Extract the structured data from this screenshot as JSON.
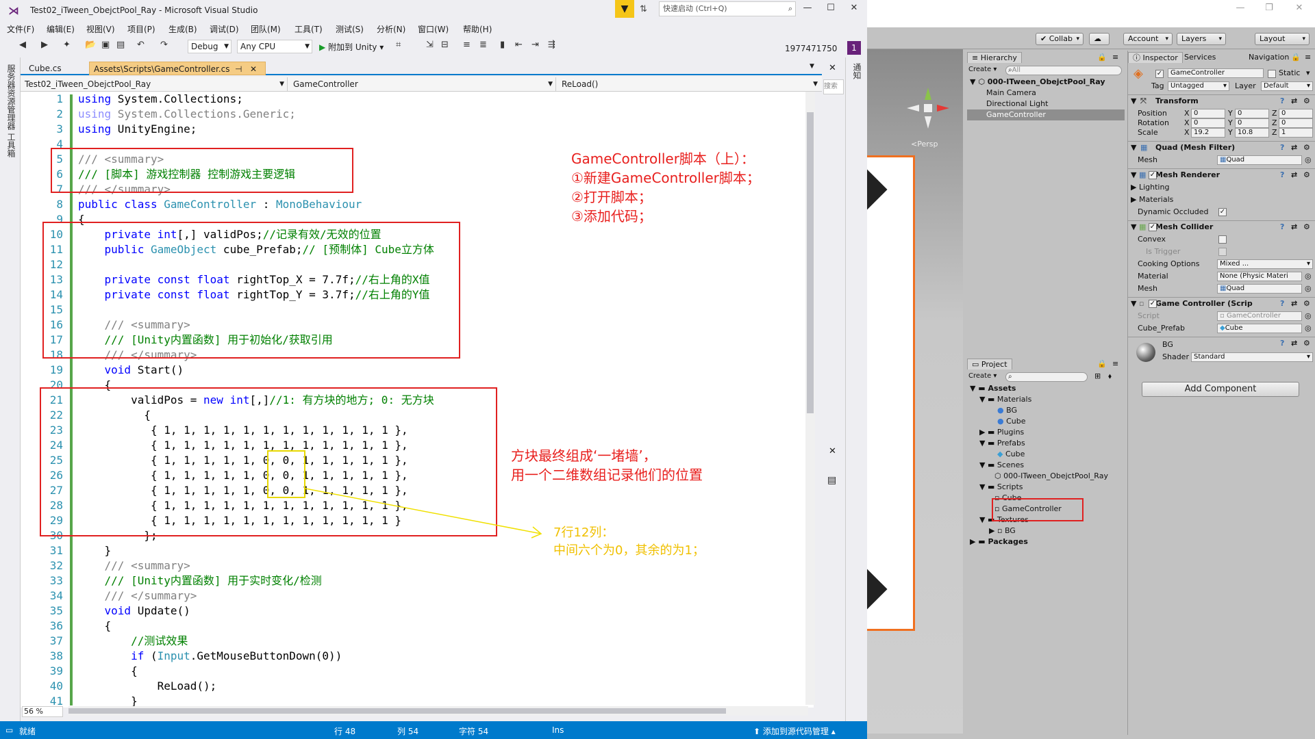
{
  "vs": {
    "title": "Test02_iTween_ObejctPool_Ray - Microsoft Visual Studio",
    "quick_launch": "快速启动 (Ctrl+Q)",
    "menu": [
      "文件(F)",
      "编辑(E)",
      "视图(V)",
      "项目(P)",
      "生成(B)",
      "调试(D)",
      "团队(M)",
      "工具(T)",
      "测试(S)",
      "分析(N)",
      "窗口(W)",
      "帮助(H)"
    ],
    "account": "1977471750",
    "notification_count": "1",
    "config": "Debug",
    "platform": "Any CPU",
    "attach": "附加到 Unity",
    "sidebar_left": [
      "服务器资源管理器",
      "工具箱"
    ],
    "sidebar_right": "通知",
    "search_label": "搜索",
    "tabs": [
      "Cube.cs",
      "Assets\\Scripts\\GameController.cs"
    ],
    "nav": [
      "Test02_iTween_ObejctPool_Ray",
      "GameController",
      "ReLoad()"
    ],
    "zoom": "56 %",
    "status": {
      "ready": "就绪",
      "row": "行 48",
      "col": "列 54",
      "char": "字符 54",
      "ins": "Ins",
      "source_control": "添加到源代码管理"
    }
  },
  "code": {
    "line_numbers": [
      "1",
      "2",
      "3",
      "4",
      "5",
      "6",
      "7",
      "8",
      "9",
      "10",
      "11",
      "12",
      "13",
      "14",
      "15",
      "16",
      "17",
      "18",
      "19",
      "20",
      "21",
      "22",
      "23",
      "24",
      "25",
      "26",
      "27",
      "28",
      "29",
      "30",
      "31",
      "32",
      "33",
      "34",
      "35",
      "36",
      "37",
      "38",
      "39",
      "40",
      "41"
    ],
    "l1a": "using",
    "l1b": " System.Collections;",
    "l2a": "using",
    "l2b": " System.Collections.Generic;",
    "l3a": "using",
    "l3b": " UnityEngine;",
    "l5": "/// <summary>",
    "l6": "/// [脚本] 游戏控制器 控制游戏主要逻辑",
    "l7": "/// </summary>",
    "l8a": "public class",
    "l8b": " GameController",
    "l8c": " : ",
    "l8d": "MonoBehaviour",
    "l9": "{",
    "l10a": "    private",
    "l10b": " int",
    "l10c": "[,] validPos;",
    "l10d": "//记录有效/无效的位置",
    "l11a": "    public",
    "l11b": " GameObject",
    "l11c": " cube_Prefab;",
    "l11d": "// [预制体] Cube立方体",
    "l13a": "    private const float",
    "l13b": " rightTop_X = 7.7f;",
    "l13c": "//右上角的X值",
    "l14a": "    private const float",
    "l14b": " rightTop_Y = 3.7f;",
    "l14c": "//右上角的Y值",
    "l16": "    /// <summary>",
    "l17": "    /// [Unity内置函数] 用于初始化/获取引用",
    "l18": "    /// </summary>",
    "l19a": "    void",
    "l19b": " Start()",
    "l20": "    {",
    "l21a": "        validPos = ",
    "l21b": "new",
    "l21c": " int",
    "l21d": "[,]",
    "l21e": "//1: 有方块的地方; 0: 无方块",
    "l22": "          {",
    "l23": "           { 1, 1, 1, 1, 1, 1, 1, 1, 1, 1, 1, 1 },",
    "l24": "           { 1, 1, 1, 1, 1, 1, 1, 1, 1, 1, 1, 1 },",
    "l25": "           { 1, 1, 1, 1, 1, 0, 0, 1, 1, 1, 1, 1 },",
    "l26": "           { 1, 1, 1, 1, 1, 0, 0, 1, 1, 1, 1, 1 },",
    "l27": "           { 1, 1, 1, 1, 1, 0, 0, 1, 1, 1, 1, 1 },",
    "l28": "           { 1, 1, 1, 1, 1, 1, 1, 1, 1, 1, 1, 1 },",
    "l29": "           { 1, 1, 1, 1, 1, 1, 1, 1, 1, 1, 1, 1 }",
    "l30": "          };",
    "l31": "    }",
    "l32": "    /// <summary>",
    "l33": "    /// [Unity内置函数] 用于实时变化/检测",
    "l34": "    /// </summary>",
    "l35a": "    void",
    "l35b": " Update()",
    "l36": "    {",
    "l37": "        //测试效果",
    "l38a": "        if",
    "l38b": " (",
    "l38c": "Input",
    "l38d": ".GetMouseButtonDown(0))",
    "l39": "        {",
    "l40": "            ReLoad();",
    "l41": "        }"
  },
  "annotations": {
    "main": [
      "GameController脚本（上）：",
      "①新建GameController脚本；",
      "②打开脚本；",
      "③添加代码；"
    ],
    "wall": [
      "方块最终组成‘一堵墙’，",
      "用一个二维数组记录他们的位置"
    ],
    "grid": [
      "7行12列：",
      "中间六个为0，其余的为1；"
    ]
  },
  "unity": {
    "toolbar": {
      "collab": "Collab",
      "account": "Account",
      "layers": "Layers",
      "layout": "Layout"
    },
    "scene_persp": "<Persp",
    "hierarchy": {
      "tab": "Hierarchy",
      "create": "Create",
      "search_placeholder": "All",
      "scene": "000-ITween_ObejctPool_Ray",
      "items": [
        "Main Camera",
        "Directional Light",
        "GameController"
      ]
    },
    "project": {
      "tab": "Project",
      "create": "Create",
      "tree": [
        "Assets",
        "Materials",
        "BG",
        "Cube",
        "Plugins",
        "Prefabs",
        "Cube",
        "Scenes",
        "000-ITween_ObejctPool_Ray",
        "Scripts",
        "Cube",
        "GameController",
        "Textures",
        "BG",
        "Packages"
      ]
    },
    "inspector": {
      "tabs": [
        "Inspector",
        "Services",
        "Navigation"
      ],
      "name": "GameController",
      "static": "Static",
      "tag_label": "Tag",
      "tag": "Untagged",
      "layer_label": "Layer",
      "layer": "Default",
      "transform": "Transform",
      "position": "Position",
      "rotation": "Rotation",
      "scale": "Scale",
      "pos": [
        "0",
        "0",
        "0"
      ],
      "rot": [
        "0",
        "0",
        "0"
      ],
      "scl": [
        "19.2",
        "10.8",
        "1"
      ],
      "x": "X",
      "y": "Y",
      "z": "Z",
      "mesh_filter": "Quad (Mesh Filter)",
      "mesh_label": "Mesh",
      "mesh_value": "Quad",
      "mesh_renderer": "Mesh Renderer",
      "lighting": "Lighting",
      "materials": "Materials",
      "dynamic_occluded": "Dynamic Occluded",
      "mesh_collider": "Mesh Collider",
      "convex": "Convex",
      "is_trigger": "Is Trigger",
      "cooking": "Cooking Options",
      "cooking_value": "Mixed ...",
      "material_label": "Material",
      "material_value": "None (Physic Materi",
      "collider_mesh": "Quad",
      "script_comp": "Game Controller (Scrip",
      "script_label": "Script",
      "script_value": "GameController",
      "cube_prefab_label": "Cube_Prefab",
      "cube_prefab_value": "Cube",
      "bg": "BG",
      "shader_label": "Shader",
      "shader_value": "Standard",
      "add_component": "Add Component"
    }
  }
}
